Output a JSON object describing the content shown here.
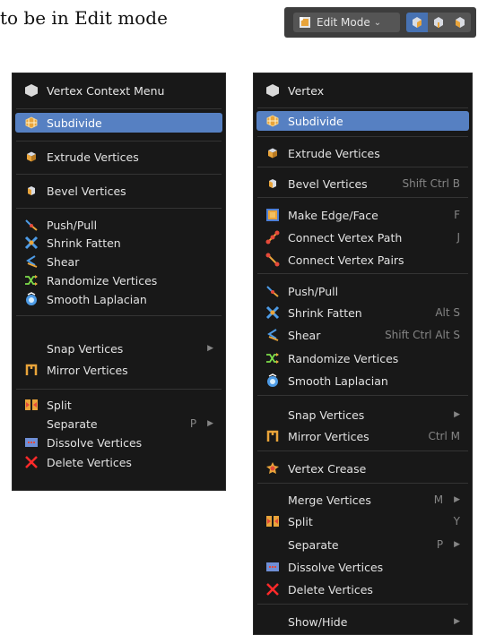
{
  "caption": "to be in Edit mode",
  "header": {
    "mode_label": "Edit Mode"
  },
  "menus": [
    {
      "title": "Vertex Context Menu",
      "items": [
        {
          "label": "Subdivide",
          "icon": "subdivide-icon",
          "highlight": true
        },
        {
          "label": "Extrude Vertices",
          "icon": "extrude-icon"
        },
        {
          "label": "Bevel Vertices",
          "icon": "bevel-icon"
        },
        {
          "label": "Push/Pull",
          "icon": "push-pull-icon"
        },
        {
          "label": "Shrink Fatten",
          "icon": "shrink-fatten-icon"
        },
        {
          "label": "Shear",
          "icon": "shear-icon"
        },
        {
          "label": "Randomize Vertices",
          "icon": "randomize-icon"
        },
        {
          "label": "Smooth Laplacian",
          "icon": "smooth-laplacian-icon"
        },
        {
          "label": "Snap Vertices",
          "submenu": true
        },
        {
          "label": "Mirror Vertices",
          "icon": "mirror-icon"
        },
        {
          "label": "Split",
          "icon": "split-icon"
        },
        {
          "label": "Separate",
          "shortcut": "P",
          "submenu": true
        },
        {
          "label": "Dissolve Vertices",
          "icon": "dissolve-icon"
        },
        {
          "label": "Delete Vertices",
          "icon": "delete-icon"
        }
      ]
    },
    {
      "title": "Vertex",
      "items": [
        {
          "label": "Subdivide",
          "icon": "subdivide-icon",
          "highlight": true
        },
        {
          "label": "Extrude Vertices",
          "icon": "extrude-icon"
        },
        {
          "label": "Bevel Vertices",
          "icon": "bevel-icon",
          "shortcut": "Shift Ctrl B"
        },
        {
          "label": "Make Edge/Face",
          "icon": "make-edge-face-icon",
          "shortcut": "F"
        },
        {
          "label": "Connect Vertex Path",
          "icon": "connect-path-icon",
          "shortcut": "J"
        },
        {
          "label": "Connect Vertex Pairs",
          "icon": "connect-pairs-icon"
        },
        {
          "label": "Push/Pull",
          "icon": "push-pull-icon"
        },
        {
          "label": "Shrink Fatten",
          "icon": "shrink-fatten-icon",
          "shortcut": "Alt S"
        },
        {
          "label": "Shear",
          "icon": "shear-icon",
          "shortcut": "Shift Ctrl Alt S"
        },
        {
          "label": "Randomize Vertices",
          "icon": "randomize-icon"
        },
        {
          "label": "Smooth Laplacian",
          "icon": "smooth-laplacian-icon"
        },
        {
          "label": "Snap Vertices",
          "submenu": true
        },
        {
          "label": "Mirror Vertices",
          "icon": "mirror-icon",
          "shortcut": "Ctrl M"
        },
        {
          "label": "Vertex Crease",
          "icon": "vertex-crease-icon"
        },
        {
          "label": "Merge Vertices",
          "shortcut": "M",
          "submenu": true
        },
        {
          "label": "Split",
          "icon": "split-icon",
          "shortcut": "Y"
        },
        {
          "label": "Separate",
          "shortcut": "P",
          "submenu": true
        },
        {
          "label": "Dissolve Vertices",
          "icon": "dissolve-icon"
        },
        {
          "label": "Delete Vertices",
          "icon": "delete-icon"
        },
        {
          "label": "Show/Hide",
          "submenu": true
        }
      ]
    }
  ]
}
